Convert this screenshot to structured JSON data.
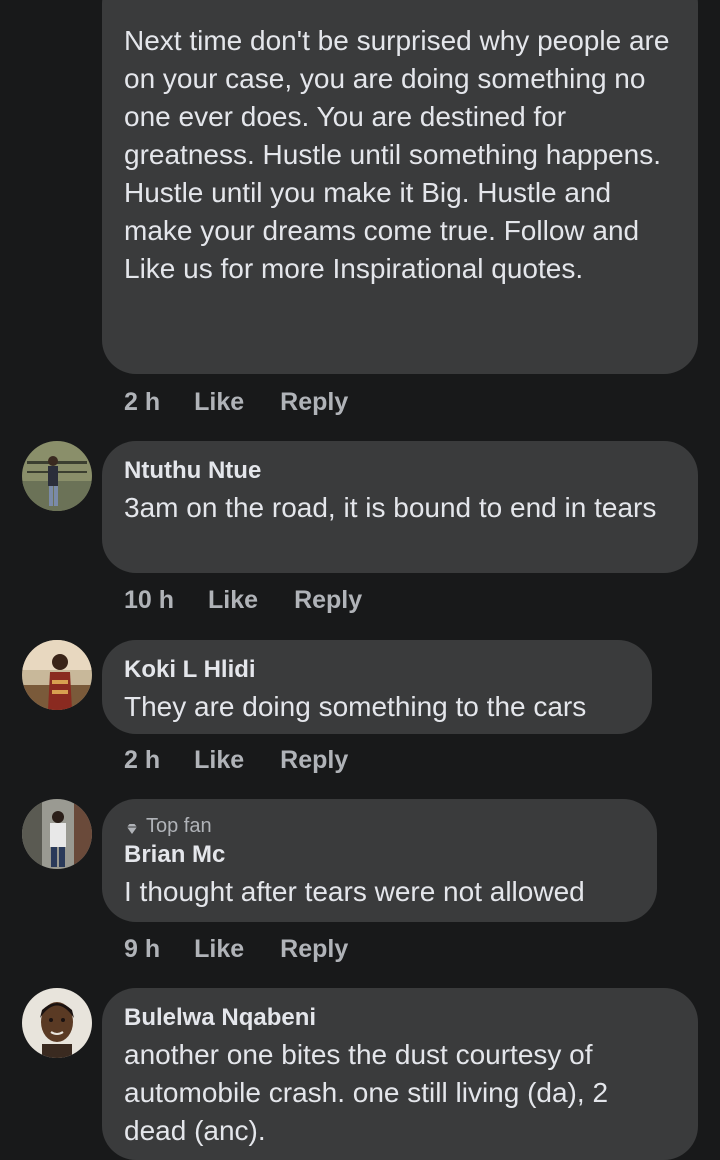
{
  "comments": [
    {
      "author": "",
      "text": "Next time don't be surprised why people are on your case, you are doing something no one ever does. You are destined for greatness. Hustle until something happens. Hustle until you make it Big. Hustle and make your dreams come true. Follow and Like us for more Inspirational quotes.",
      "time": "2 h",
      "like_label": "Like",
      "reply_label": "Reply"
    },
    {
      "author": "Ntuthu Ntue",
      "text": "3am on the road, it is bound to end in tears",
      "time": "10 h",
      "like_label": "Like",
      "reply_label": "Reply"
    },
    {
      "author": "Koki L Hlidi",
      "text": "They are doing something to the cars",
      "time": "2 h",
      "like_label": "Like",
      "reply_label": "Reply"
    },
    {
      "badge": "Top fan",
      "author": "Brian Mc",
      "text": "I thought after tears were not allowed",
      "time": "9 h",
      "like_label": "Like",
      "reply_label": "Reply"
    },
    {
      "author": "Bulelwa Nqabeni",
      "text": "another one bites the dust courtesy of automobile crash. one still living (da), 2 dead (anc).",
      "time": "",
      "like_label": "",
      "reply_label": ""
    }
  ],
  "icons": {
    "top_fan_badge": "diamond-badge-icon"
  }
}
